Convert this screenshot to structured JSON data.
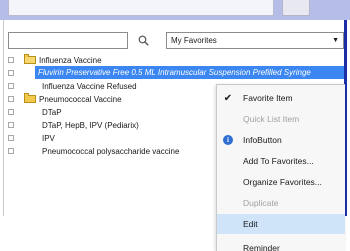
{
  "search": {
    "value": "",
    "placeholder": ""
  },
  "favorites_filter": {
    "selected": "My Favorites"
  },
  "tree": {
    "items": [
      {
        "label": "Influenza Vaccine",
        "type": "folder-open"
      },
      {
        "label": "Fluvirin Preservative Free 0.5 ML Intramuscular Suspension Prefilled Syringe",
        "type": "item",
        "selected": true
      },
      {
        "label": "Influenza Vaccine Refused",
        "type": "item"
      },
      {
        "label": "Pneumococcal Vaccine",
        "type": "folder"
      },
      {
        "label": "DTaP",
        "type": "item"
      },
      {
        "label": "DTaP, HepB, IPV (Pediarix)",
        "type": "item"
      },
      {
        "label": "IPV",
        "type": "item"
      },
      {
        "label": "Pneumococcal polysaccharide vaccine",
        "type": "item"
      }
    ]
  },
  "context_menu": {
    "items": [
      {
        "label": "Favorite Item",
        "icon": "check-icon",
        "enabled": true
      },
      {
        "label": "Quick List Item",
        "icon": "",
        "enabled": false
      },
      {
        "label": "InfoButton",
        "icon": "info-icon",
        "enabled": true
      },
      {
        "label": "Add To Favorites...",
        "icon": "",
        "enabled": true
      },
      {
        "label": "Organize Favorites...",
        "icon": "",
        "enabled": true
      },
      {
        "label": "Duplicate",
        "icon": "",
        "enabled": false
      },
      {
        "label": "Edit",
        "icon": "",
        "enabled": true,
        "highlighted": true
      },
      {
        "label": "Reminder",
        "icon": "",
        "enabled": true
      }
    ]
  },
  "colors": {
    "selection": "#3b86f0",
    "menu_hover": "#cfe3f9",
    "header_band": "#b7bde9",
    "folder": "#f2c94c"
  }
}
